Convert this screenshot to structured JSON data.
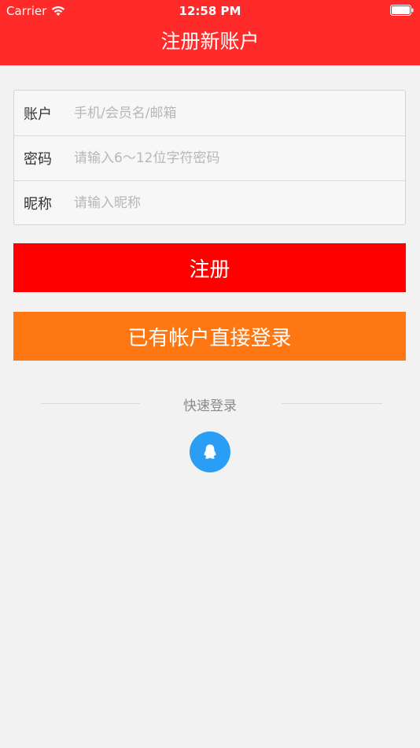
{
  "status_bar": {
    "carrier": "Carrier",
    "time": "12:58 PM",
    "wifi_icon": "wifi-icon",
    "battery_icon": "battery-icon"
  },
  "nav": {
    "title": "注册新账户"
  },
  "form": {
    "account": {
      "label": "账户",
      "placeholder": "手机/会员名/邮箱",
      "value": ""
    },
    "password": {
      "label": "密码",
      "placeholder": "请输入6～12位字符密码",
      "value": ""
    },
    "nickname": {
      "label": "昵称",
      "placeholder": "请输入昵称",
      "value": ""
    }
  },
  "buttons": {
    "register": "注册",
    "login_existing": "已有帐户直接登录"
  },
  "quick_login": {
    "label": "快速登录",
    "qq_icon": "qq-icon"
  },
  "colors": {
    "nav_bg": "#ff2a2a",
    "register_bg": "#ff0000",
    "login_bg": "#ff7712",
    "qq_bg": "#2a9df4",
    "page_bg": "#f2f2f2"
  }
}
